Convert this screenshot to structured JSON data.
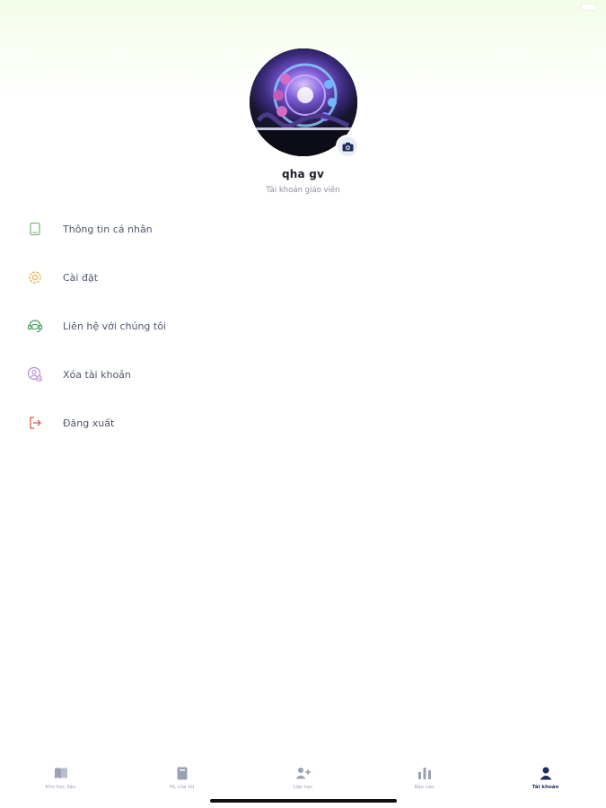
{
  "profile": {
    "name": "qha gv",
    "role": "Tài khoản giáo viên",
    "avatar_icon": "avatar-image",
    "camera_icon": "camera-icon"
  },
  "menu": {
    "items": [
      {
        "label": "Thông tin cá nhân",
        "icon": "profile-card-icon",
        "color": "#7fb87f"
      },
      {
        "label": "Cài đặt",
        "icon": "settings-icon",
        "color": "#e8b04a"
      },
      {
        "label": "Liên hệ với chúng tôi",
        "icon": "support-icon",
        "color": "#4a9e5c"
      },
      {
        "label": "Xóa tài khoản",
        "icon": "delete-account-icon",
        "color": "#b58ad6"
      },
      {
        "label": "Đăng xuất",
        "icon": "logout-icon",
        "color": "#e0574f"
      }
    ]
  },
  "nav": {
    "items": [
      {
        "label": "Kho học liệu",
        "icon": "book-open-icon",
        "active": false
      },
      {
        "label": "HL của tôi",
        "icon": "book-icon",
        "active": false
      },
      {
        "label": "Lớp học",
        "icon": "people-icon",
        "active": false
      },
      {
        "label": "Báo cáo",
        "icon": "bar-chart-icon",
        "active": false
      },
      {
        "label": "Tài khoản",
        "icon": "user-icon",
        "active": true
      }
    ],
    "active_color": "#1d2b5c",
    "inactive_color": "#9aa1b2"
  }
}
